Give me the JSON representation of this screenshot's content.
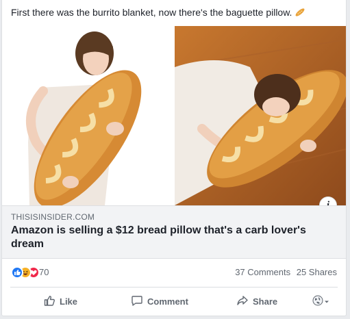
{
  "post": {
    "text": "First there was the burrito blanket, now there's the baguette pillow."
  },
  "link_preview": {
    "domain": "THISISINSIDER.COM",
    "title": "Amazon is selling a $12 bread pillow that's a carb lover's dream"
  },
  "stats": {
    "reaction_count": "70",
    "comments": "37 Comments",
    "shares": "25 Shares"
  },
  "actions": {
    "like": "Like",
    "comment": "Comment",
    "share": "Share"
  },
  "colors": {
    "like_blue": "#2078f4",
    "haha_yellow": "#f7b125",
    "love_red": "#f0284a",
    "muted_text": "#606770"
  },
  "icons": [
    "baguette-emoji-icon",
    "info-icon",
    "like-reaction-icon",
    "haha-reaction-icon",
    "love-reaction-icon",
    "thumbs-up-icon",
    "comment-icon",
    "share-icon",
    "globe-icon",
    "chevron-down-icon"
  ]
}
